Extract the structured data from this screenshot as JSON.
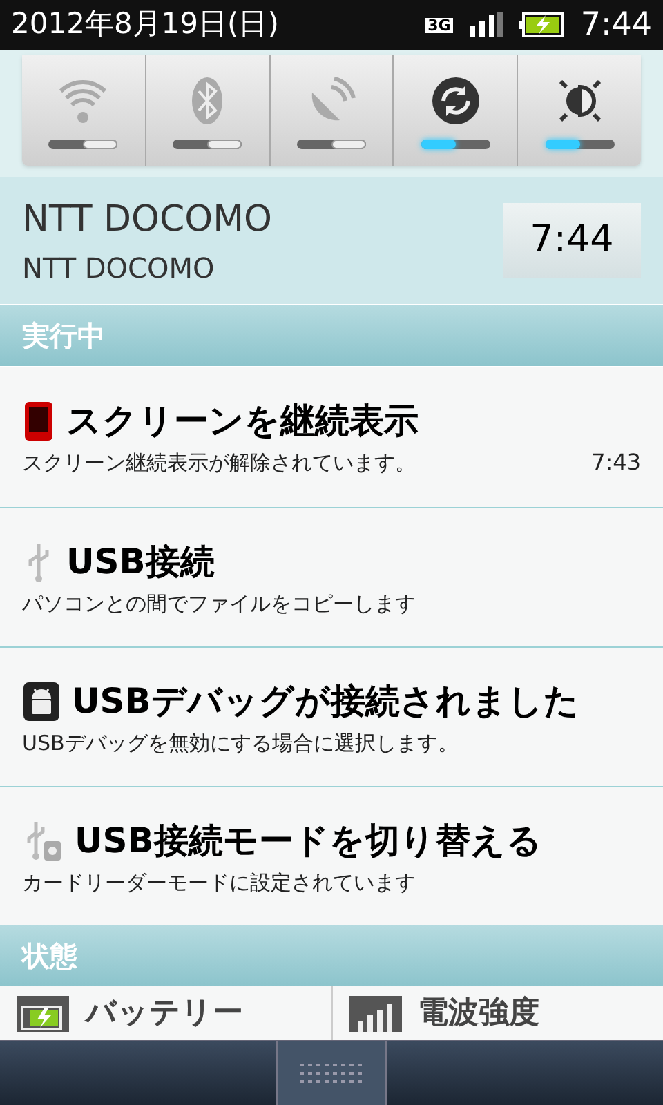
{
  "status_bar": {
    "date": "2012年8月19日(日)",
    "network": "3G",
    "time": "7:44"
  },
  "toggles": [
    {
      "on": false
    },
    {
      "on": false
    },
    {
      "on": false
    },
    {
      "on": true
    },
    {
      "on": true
    }
  ],
  "carrier": {
    "name": "NTT DOCOMO",
    "subname": "NTT DOCOMO",
    "clock": "7:44"
  },
  "ongoing": {
    "header": "実行中",
    "items": [
      {
        "kind": "phone",
        "title": "スクリーンを継続表示",
        "subtitle": "スクリーン継続表示が解除されています。",
        "time": "7:43"
      },
      {
        "kind": "usb",
        "title": "USB接続",
        "subtitle": "パソコンとの間でファイルをコピーします"
      },
      {
        "kind": "debug",
        "title": "USBデバッグが接続されました",
        "subtitle": "USBデバッグを無効にする場合に選択します。"
      },
      {
        "kind": "usbmode",
        "title": "USB接続モードを切り替える",
        "subtitle": "カードリーダーモードに設定されています"
      }
    ]
  },
  "status": {
    "header": "状態",
    "items": [
      {
        "kind": "battery",
        "label": "バッテリー"
      },
      {
        "kind": "signal",
        "label": "電波強度"
      }
    ]
  }
}
